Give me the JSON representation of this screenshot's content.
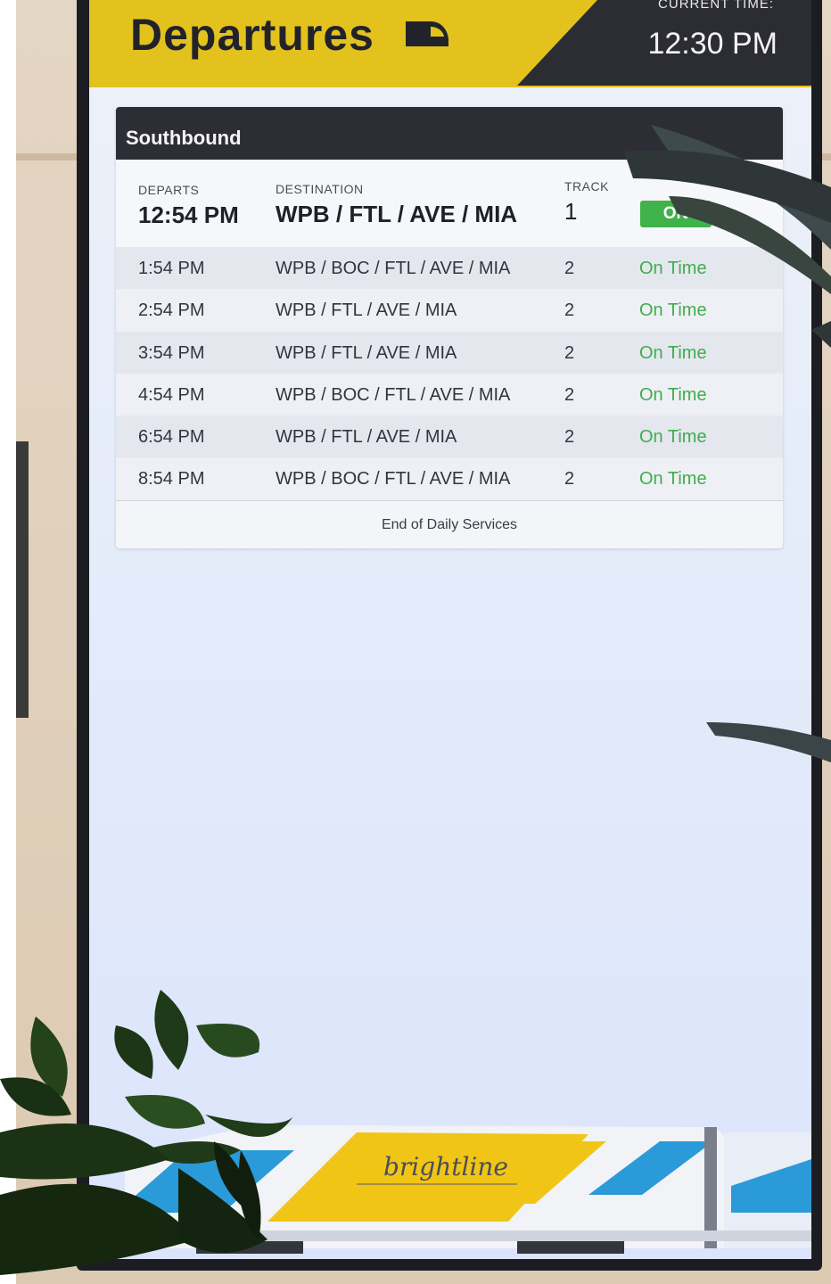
{
  "header": {
    "title": "Departures",
    "current_time_label": "CURRENT TIME:",
    "current_time": "12:30 PM",
    "icon": "train-icon"
  },
  "board": {
    "direction": "Southbound",
    "columns": {
      "departs": "DEPARTS",
      "destination": "DESTINATION",
      "track": "TRACK"
    },
    "next_departure": {
      "time": "12:54 PM",
      "destination": "WPB / FTL / AVE / MIA",
      "track": "1",
      "status": "ON"
    },
    "departures": [
      {
        "time": "1:54 PM",
        "destination": "WPB / BOC / FTL / AVE / MIA",
        "track": "2",
        "status": "On Time"
      },
      {
        "time": "2:54 PM",
        "destination": "WPB / FTL / AVE / MIA",
        "track": "2",
        "status": "On Time"
      },
      {
        "time": "3:54 PM",
        "destination": "WPB / FTL / AVE / MIA",
        "track": "2",
        "status": "On Time"
      },
      {
        "time": "4:54 PM",
        "destination": "WPB / BOC / FTL / AVE / MIA",
        "track": "2",
        "status": "On Time"
      },
      {
        "time": "6:54 PM",
        "destination": "WPB / FTL / AVE / MIA",
        "track": "2",
        "status": "On Time"
      },
      {
        "time": "8:54 PM",
        "destination": "WPB / BOC / FTL / AVE / MIA",
        "track": "2",
        "status": "On Time"
      }
    ],
    "footer": "End of Daily Services"
  },
  "brand": {
    "logo_text": "brightline"
  },
  "colors": {
    "header_yellow": "#e3c21e",
    "header_dark": "#2c2d33",
    "on_time_green": "#3fae4c"
  }
}
